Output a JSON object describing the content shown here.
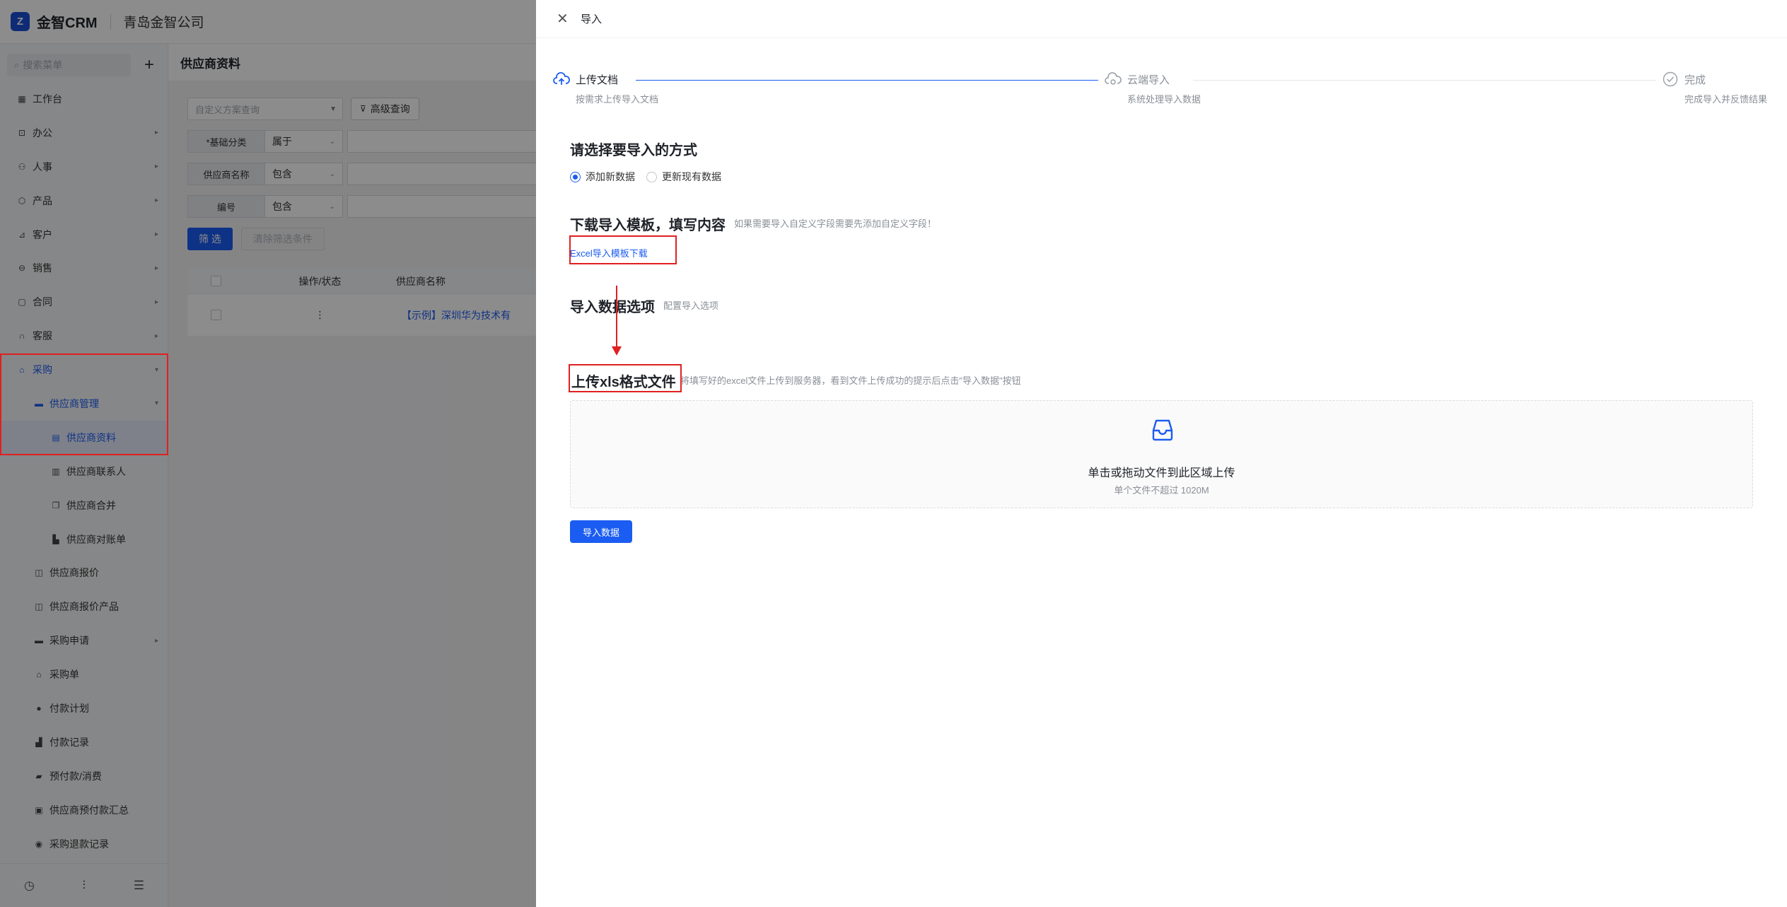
{
  "topbar": {
    "logo_glyph": "Z",
    "brand": "金智CRM",
    "company": "青岛金智公司"
  },
  "sidebar": {
    "search_placeholder": "搜索菜单",
    "add_icon": "plus-icon",
    "items": [
      {
        "label": "工作台",
        "icon": "dashboard-icon"
      },
      {
        "label": "办公",
        "icon": "office-icon"
      },
      {
        "label": "人事",
        "icon": "people-icon"
      },
      {
        "label": "产品",
        "icon": "product-icon"
      },
      {
        "label": "客户",
        "icon": "customer-icon"
      },
      {
        "label": "销售",
        "icon": "sales-icon"
      },
      {
        "label": "合同",
        "icon": "contract-icon"
      },
      {
        "label": "客服",
        "icon": "service-icon"
      },
      {
        "label": "采购",
        "icon": "purchase-icon"
      },
      {
        "label": "供应商管理",
        "icon": "folder-icon"
      },
      {
        "label": "供应商资料",
        "icon": "document-icon"
      },
      {
        "label": "供应商联系人",
        "icon": "contacts-icon"
      },
      {
        "label": "供应商合并",
        "icon": "merge-icon"
      },
      {
        "label": "供应商对账单",
        "icon": "statement-icon"
      },
      {
        "label": "供应商报价",
        "icon": "quote-icon"
      },
      {
        "label": "供应商报价产品",
        "icon": "quote-product-icon"
      },
      {
        "label": "采购申请",
        "icon": "folder-icon"
      },
      {
        "label": "采购单",
        "icon": "order-icon"
      },
      {
        "label": "付款计划",
        "icon": "plan-icon"
      },
      {
        "label": "付款记录",
        "icon": "record-icon"
      },
      {
        "label": "预付款/消费",
        "icon": "prepay-icon"
      },
      {
        "label": "供应商预付款汇总",
        "icon": "summary-icon"
      },
      {
        "label": "采购退款记录",
        "icon": "refund-icon"
      }
    ]
  },
  "main": {
    "page_title": "供应商资料",
    "scheme_placeholder": "自定义方案查询",
    "advanced_query": "高级查询",
    "filters": [
      {
        "label": "*基础分类",
        "op": "属于"
      },
      {
        "label": "供应商名称",
        "op": "包含"
      },
      {
        "label": "编号",
        "op": "包含"
      }
    ],
    "filter_button": "筛 选",
    "clear_button": "清除筛选条件",
    "table": {
      "columns": [
        "操作/状态",
        "供应商名称"
      ],
      "rows": [
        {
          "action": "⋮",
          "name": "【示例】深圳华为技术有"
        }
      ]
    }
  },
  "drawer": {
    "title": "导入",
    "steps": [
      {
        "title": "上传文档",
        "desc": "按需求上传导入文档"
      },
      {
        "title": "云端导入",
        "desc": "系统处理导入数据"
      },
      {
        "title": "完成",
        "desc": "完成导入并反馈结果"
      }
    ],
    "section_method": {
      "title": "请选择要导入的方式",
      "options": [
        "添加新数据",
        "更新现有数据"
      ]
    },
    "section_template": {
      "title": "下载导入模板，填写内容",
      "hint": "如果需要导入自定义字段需要先添加自定义字段！",
      "link": "Excel导入模板下载"
    },
    "section_options": {
      "title": "导入数据选项",
      "hint": "配置导入选项"
    },
    "section_upload": {
      "title": "上传xls格式文件",
      "hint": "将填写好的excel文件上传到服务器，看到文件上传成功的提示后点击\"导入数据\"按钮",
      "drop_text": "单击或拖动文件到此区域上传",
      "drop_sub": "单个文件不超过 1020M"
    },
    "import_button": "导入数据"
  },
  "colors": {
    "primary": "#1b5cf2",
    "annotation": "#e02020",
    "overlay": "rgba(0,0,0,0.45)"
  }
}
